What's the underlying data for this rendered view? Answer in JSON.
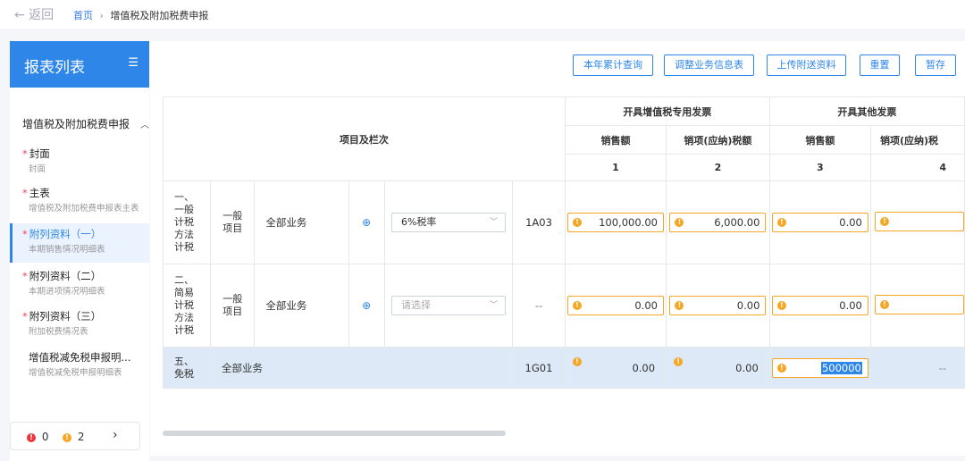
{
  "nav": {
    "back_label": "← 返回",
    "home": "首页",
    "separator": "›",
    "current": "增值税及附加税费申报"
  },
  "sidebar": {
    "title": "报表列表",
    "menu_icon": "list-collapse-icon",
    "group": "增值税及附加税费申报",
    "items": [
      {
        "title": "封面",
        "sub": "封面",
        "required": true
      },
      {
        "title": "主表",
        "sub": "增值税及附加税费申报表主表",
        "required": true
      },
      {
        "title": "附列资料（一）",
        "sub": "本期销售情况明细表",
        "required": true,
        "active": true
      },
      {
        "title": "附列资料（二）",
        "sub": "本期进项情况明细表",
        "required": true
      },
      {
        "title": "附列资料（三）",
        "sub": "附加税费情况表",
        "required": true
      },
      {
        "title": "增值税减免税申报明...",
        "sub": "增值税减免税申报明细表",
        "required": false
      }
    ],
    "status": {
      "errors": "0",
      "warnings": "2",
      "next": "›"
    }
  },
  "toolbar": {
    "annual_query": "本年累计查询",
    "adjust_info": "调整业务信息表",
    "upload": "上传附送资料",
    "reset": "重置",
    "save_draft": "暂存"
  },
  "table": {
    "header": {
      "item_col": "项目及栏次",
      "group1": "开具增值税专用发票",
      "group2": "开具其他发票",
      "sales": "销售额",
      "tax": "销项(应纳)税额",
      "tax_trunc": "销项(应纳)税",
      "nums": [
        "1",
        "2",
        "3",
        "4"
      ]
    },
    "rows": [
      {
        "category": "一、一般计税方法计税",
        "sub": "一般项目",
        "business": "全部业务",
        "rate": "6%税率",
        "code": "1A03",
        "v1": "100,000.00",
        "v2": "6,000.00",
        "v3": "0.00"
      },
      {
        "category": "二、简易计税方法计税",
        "sub": "一般项目",
        "business": "全部业务",
        "rate_placeholder": "请选择",
        "code": "--",
        "v1": "0.00",
        "v2": "0.00",
        "v3": "0.00"
      },
      {
        "category": "五、免税",
        "business": "全部业务",
        "code": "1G01",
        "v1": "0.00",
        "v2": "0.00",
        "v3": "500000",
        "v4": "--"
      }
    ]
  },
  "colors": {
    "accent": "#2d86e8",
    "warning": "#f5a623",
    "error": "#e8343a",
    "highlight_row": "#dde9f7"
  }
}
